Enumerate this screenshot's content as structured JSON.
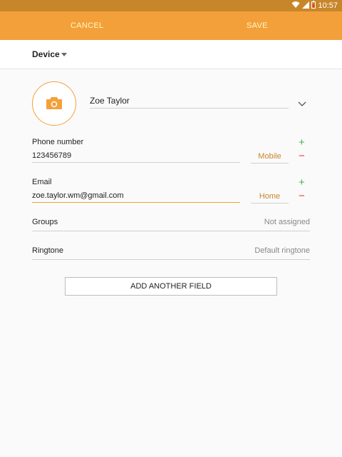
{
  "status_bar": {
    "time": "10:57",
    "icons": [
      "wifi-icon",
      "signal-icon",
      "battery-icon"
    ]
  },
  "action_bar": {
    "cancel_label": "CANCEL",
    "save_label": "SAVE"
  },
  "storage": {
    "label": "Device"
  },
  "contact": {
    "name": "Zoe Taylor",
    "phone": {
      "label": "Phone number",
      "value": "123456789",
      "type": "Mobile"
    },
    "email": {
      "label": "Email",
      "value": "zoe.taylor.wm@gmail.com",
      "type": "Home"
    },
    "groups": {
      "label": "Groups",
      "value": "Not assigned"
    },
    "ringtone": {
      "label": "Ringtone",
      "value": "Default ringtone"
    }
  },
  "add_field_label": "ADD ANOTHER FIELD",
  "colors": {
    "accent": "#f4a03a",
    "status_bar": "#c8862a",
    "add": "#4caf50",
    "remove": "#e53935"
  },
  "symbols": {
    "plus": "+",
    "minus": "−"
  }
}
